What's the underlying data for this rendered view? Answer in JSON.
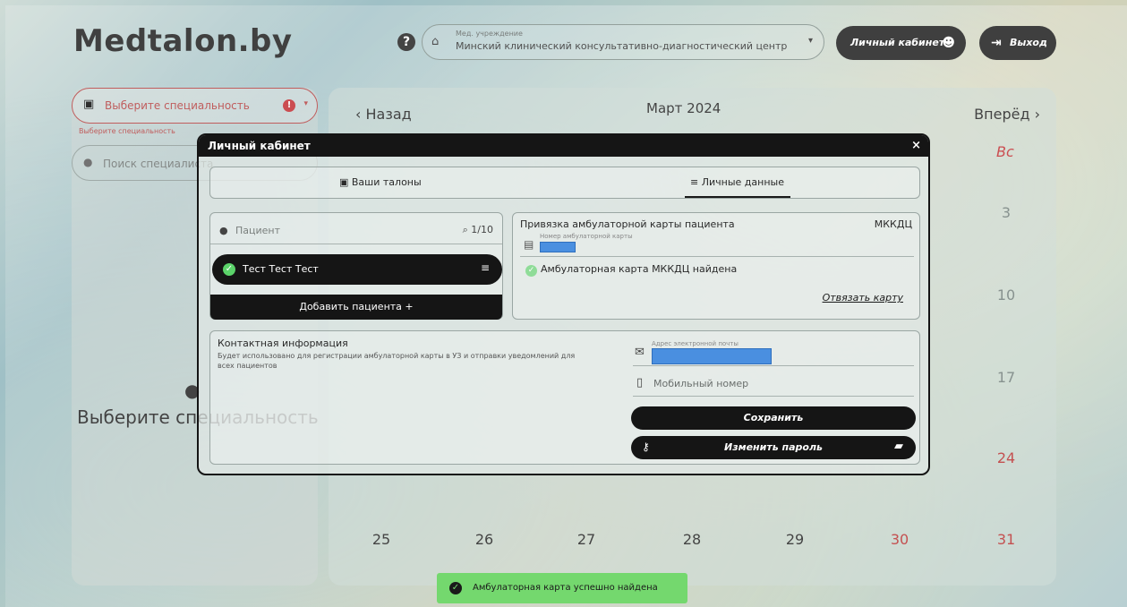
{
  "header": {
    "brand": "Medtalon.by",
    "help_icon": "question-circle-icon",
    "institution": {
      "label": "Мед. учреждение",
      "value": "Минский клинический консультативно-диагностический центр"
    },
    "cabinet_label": "Личный кабинет",
    "exit_label": "Выход"
  },
  "left_panel": {
    "specialty_placeholder": "Выберите специальность",
    "specialty_error": "Выберите специальность",
    "search_placeholder": "Поиск специалиста",
    "empty_title": "Выберите специальность"
  },
  "calendar": {
    "back_label": "Назад",
    "month": "Март 2024",
    "forward_label": "Вперёд",
    "sunday_label": "Вс",
    "sunday_dates": [
      "3",
      "10",
      "17",
      "24"
    ],
    "last_week": [
      "25",
      "26",
      "27",
      "28",
      "29",
      "30",
      "31"
    ]
  },
  "modal": {
    "title": "Личный кабинет",
    "close": "×",
    "tabs": [
      {
        "label": "Ваши талоны"
      },
      {
        "label": "Личные данные"
      }
    ],
    "patients": {
      "search_placeholder": "Пациент",
      "count": "1/10",
      "items": [
        {
          "name": "Тест Тест Тест"
        }
      ],
      "add_label": "Добавить пациента +"
    },
    "card": {
      "title": "Привязка амбулаторной карты пациента",
      "org": "МККДЦ",
      "number_label": "Номер амбулаторной карты",
      "found_text": "Амбулаторная карта МККДЦ найдена",
      "unlink_label": "Отвязать карту"
    },
    "contact": {
      "title": "Контактная информация",
      "description": "Будет использовано для регистрации амбулаторной карты в УЗ и отправки уведомлений для всех пациентов",
      "email_label": "Адрес электронной почты",
      "phone_placeholder": "Мобильный номер",
      "save_label": "Сохранить",
      "change_password_label": "Изменить пароль"
    }
  },
  "toast": {
    "text": "Амбулаторная карта успешно найдена",
    "color": "#74d86e"
  }
}
